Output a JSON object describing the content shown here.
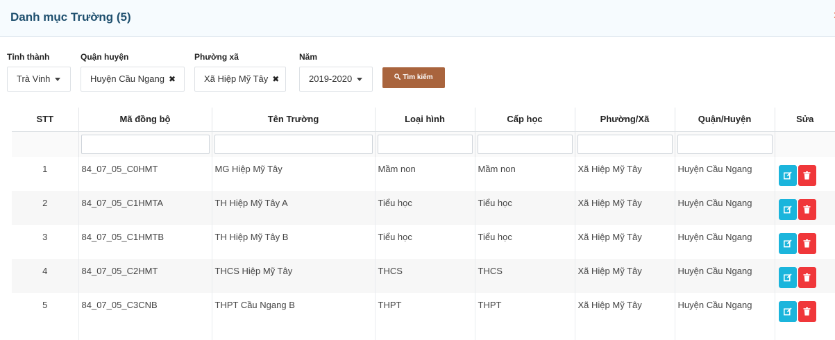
{
  "header": {
    "title": "Danh mục Trường (5)"
  },
  "filters": [
    {
      "label": "Tỉnh thành",
      "value": "Trà Vinh",
      "control": "dropdown"
    },
    {
      "label": "Quận huyện",
      "value": "Huyện Cầu Ngang",
      "control": "clearable"
    },
    {
      "label": "Phường xã",
      "value": "Xã Hiệp Mỹ Tây",
      "control": "clearable"
    },
    {
      "label": "Năm",
      "value": "2019-2020",
      "control": "dropdown"
    }
  ],
  "search_button": {
    "label": "Tìm kiếm"
  },
  "table": {
    "columns": [
      "STT",
      "Mã đồng bộ",
      "Tên Trường",
      "Loại hình",
      "Cấp học",
      "Phường/Xã",
      "Quận/Huyện",
      "Sửa"
    ],
    "rows": [
      [
        "1",
        "84_07_05_C0HMT",
        "MG Hiệp Mỹ Tây",
        "Mầm non",
        "Mầm non",
        "Xã Hiệp Mỹ Tây",
        "Huyện Cầu Ngang"
      ],
      [
        "2",
        "84_07_05_C1HMTA",
        "TH Hiệp Mỹ Tây A",
        "Tiểu học",
        "Tiểu học",
        "Xã Hiệp Mỹ Tây",
        "Huyện Cầu Ngang"
      ],
      [
        "3",
        "84_07_05_C1HMTB",
        "TH Hiệp Mỹ Tây B",
        "Tiểu học",
        "Tiểu học",
        "Xã Hiệp Mỹ Tây",
        "Huyện Cầu Ngang"
      ],
      [
        "4",
        "84_07_05_C2HMT",
        "THCS Hiệp Mỹ Tây",
        "THCS",
        "THCS",
        "Xã Hiệp Mỹ Tây",
        "Huyện Cầu Ngang"
      ],
      [
        "5",
        "84_07_05_C3CNB",
        "THPT Cầu Ngang B",
        "THPT",
        "THPT",
        "Xã Hiệp Mỹ Tây",
        "Huyện Cầu Ngang"
      ]
    ]
  },
  "icons": {
    "search": "search-icon",
    "edit": "edit-icon",
    "delete": "trash-icon",
    "clear": "close-icon",
    "dropdown": "caret-down-icon"
  },
  "colors": {
    "title": "#1e4f6e",
    "search_button": "#a9643d",
    "edit_button": "#1bb5dc",
    "delete_button": "#f0373a"
  }
}
